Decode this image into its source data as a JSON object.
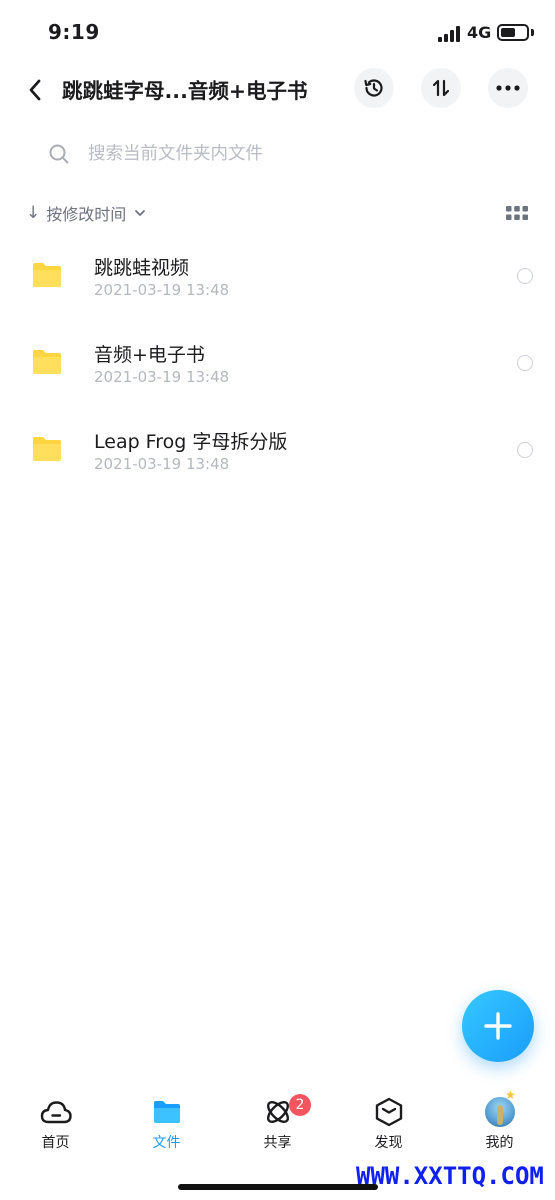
{
  "status_bar": {
    "time": "9:19",
    "network": "4G",
    "battery_level": 0.6
  },
  "header": {
    "title": "跳跳蛙字母...音频+电子书"
  },
  "search": {
    "placeholder": "搜索当前文件夹内文件",
    "value": ""
  },
  "sort": {
    "label": "按修改时间",
    "arrow": "↓"
  },
  "files": [
    {
      "name": "跳跳蛙视频",
      "date": "2021-03-19 13:48",
      "icon": "folder-icon"
    },
    {
      "name": "音频+电子书",
      "date": "2021-03-19 13:48",
      "icon": "folder-icon"
    },
    {
      "name": "Leap Frog 字母拆分版",
      "date": "2021-03-19 13:48",
      "icon": "folder-icon"
    }
  ],
  "tabs": [
    {
      "label": "首页",
      "icon": "cloud-icon",
      "active": false
    },
    {
      "label": "文件",
      "icon": "folder-icon",
      "active": true
    },
    {
      "label": "共享",
      "icon": "orbit-icon",
      "active": false,
      "badge": "2"
    },
    {
      "label": "发现",
      "icon": "cube-icon",
      "active": false
    },
    {
      "label": "我的",
      "icon": "avatar",
      "active": false
    }
  ],
  "watermark": "WWW.XXTTQ.COM",
  "colors": {
    "accent": "#1a9dfb",
    "folder": "#ffd63f",
    "badge": "#f6545e",
    "watermark": "#1020f0"
  }
}
